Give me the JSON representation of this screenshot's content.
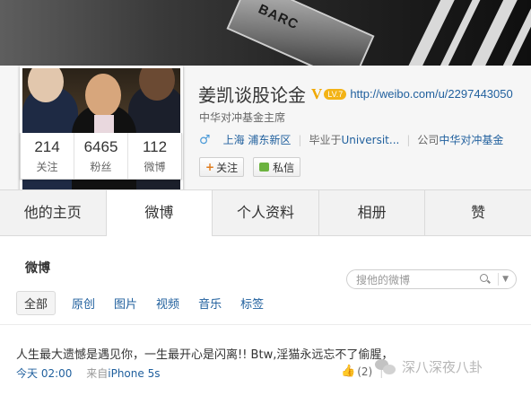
{
  "cover": {
    "bag_text": "BARC"
  },
  "profile": {
    "name": "姜凯谈股论金",
    "verified_glyph": "V",
    "level_badge": "LV.7",
    "url": "http://weibo.com/u/2297443050",
    "bio": "中华对冲基金主席",
    "gender_glyph": "♂",
    "location": "上海 浦东新区",
    "school_prefix": "毕业于",
    "school": "Universit...",
    "company_prefix": "公司",
    "company": "中华对冲基金"
  },
  "stats": [
    {
      "num": "214",
      "label": "关注"
    },
    {
      "num": "6465",
      "label": "粉丝"
    },
    {
      "num": "112",
      "label": "微博"
    }
  ],
  "buttons": {
    "follow_plus": "+",
    "follow": "关注",
    "message": "私信"
  },
  "tabs": [
    "他的主页",
    "微博",
    "个人资料",
    "相册",
    "赞"
  ],
  "section_title": "微博",
  "search": {
    "placeholder": "搜他的微博"
  },
  "filters": [
    "全部",
    "原创",
    "图片",
    "视频",
    "音乐",
    "标签"
  ],
  "post": {
    "text": "人生最大遗憾是遇见你，一生最开心是闪离!! Btw,淫猫永远忘不了偷腥，",
    "time": "今天 02:00",
    "source_prefix": "来自",
    "source": "iPhone 5s",
    "likes": "(2)",
    "likes_sep": "|"
  },
  "watermark": "深八深夜八卦",
  "colors": {
    "link": "#1f5f9d",
    "verified": "#f0a800",
    "follow_plus": "#e07b1c",
    "message_icon": "#6cb33f"
  }
}
